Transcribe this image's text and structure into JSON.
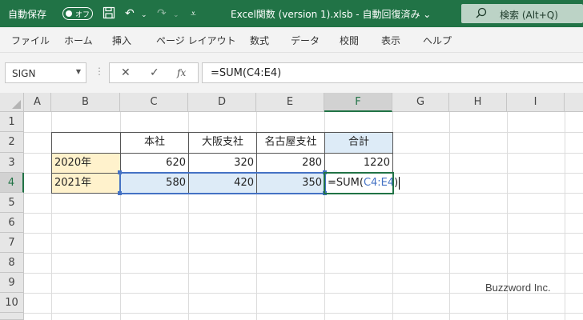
{
  "titlebar": {
    "autosave_label": "自動保存",
    "autosave_state": "オフ",
    "save_icon": "save-icon",
    "undo_icon": "undo-icon",
    "redo_icon": "redo-icon",
    "customize_icon": "customize-qat-icon",
    "file_title": "Excel関数 (version 1).xlsb  -  自動回復済み  ⌄",
    "search_placeholder": "検索 (Alt+Q)",
    "accent": "#217346"
  },
  "ribbon": {
    "tabs": [
      "ファイル",
      "ホーム",
      "挿入",
      "ページ レイアウト",
      "数式",
      "データ",
      "校閲",
      "表示",
      "ヘルプ"
    ]
  },
  "formula_bar": {
    "name_box": "SIGN",
    "cancel": "✕",
    "enter": "✓",
    "fx": "fx",
    "formula": "=SUM(C4:E4)"
  },
  "sheet": {
    "columns": [
      "A",
      "B",
      "C",
      "D",
      "E",
      "F",
      "G",
      "H",
      "I"
    ],
    "rows": [
      "1",
      "2",
      "3",
      "4",
      "5",
      "6",
      "7",
      "8",
      "9",
      "10"
    ],
    "header_row": [
      "本社",
      "大阪支社",
      "名古屋支社",
      "合計"
    ],
    "data_rows": [
      {
        "label": "2020年",
        "values": [
          "620",
          "320",
          "280",
          "1220"
        ]
      },
      {
        "label": "2021年",
        "values": [
          "580",
          "420",
          "350"
        ]
      }
    ],
    "editing_prefix": "=SUM(",
    "editing_ref": "C4:E4",
    "editing_suffix": ")",
    "watermark": "Buzzword Inc."
  }
}
